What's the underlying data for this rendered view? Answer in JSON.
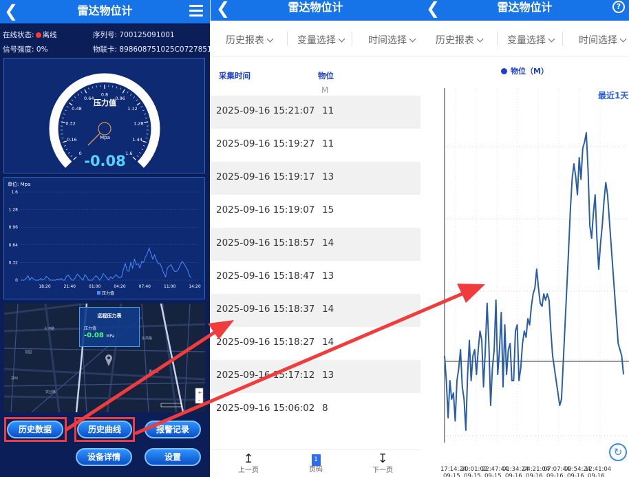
{
  "dashboard": {
    "title": "雷达物位计",
    "online_status_label": "在线状态:",
    "online_status_value": "离线",
    "serial_label": "序列号:",
    "serial_value": "700125091001",
    "signal_label": "信号强度:",
    "signal_value": "0%",
    "iot_card_label": "物联卡:",
    "iot_card_value": "898608751025C0727851",
    "gauge": {
      "title": "压力值",
      "unit": "Mpa",
      "value": "-0.08",
      "value_number": -0.08,
      "min": 0,
      "max": 1.6,
      "ticks": [
        "0",
        "0.16",
        "0.32",
        "0.48",
        "0.64",
        "0.8",
        "0.96",
        "1.12",
        "1.28",
        "1.44",
        "1.6"
      ]
    },
    "mini_chart": {
      "type": "line",
      "unit_label": "单位: Mpa",
      "ytick_labels": [
        "0",
        "0.32",
        "0.64",
        "0.96",
        "1.28",
        "1.6"
      ],
      "ylim": [
        0,
        1.6
      ],
      "xtick_labels": [
        "18:20",
        "21:40",
        "01:00",
        "04:20",
        "07:40",
        "11:00",
        "14:20"
      ],
      "legend": "压力值",
      "series_values": [
        0.0,
        0.0,
        0.0,
        0.03,
        0.08,
        0.0,
        0.05,
        0.02,
        0.0,
        0.0,
        0.0,
        0.03,
        0.0,
        0.02,
        0.07,
        0.04,
        0.0,
        0.0,
        0.0,
        0.0,
        0.02,
        0.0,
        0.03,
        0.0,
        0.0,
        0.07,
        0.09,
        0.04,
        0.0,
        0.0,
        0.06,
        0.11,
        0.07,
        0.03,
        0.0,
        0.1,
        0.06,
        0.0,
        0.0,
        0.0,
        0.04,
        0.08,
        0.05,
        0.0,
        0.04,
        0.12,
        0.08,
        0.04,
        0.0,
        0.06,
        0.03,
        0.06,
        0.1,
        0.06,
        0.04,
        0.06,
        0.2,
        0.3,
        0.18,
        0.16,
        0.32,
        0.22,
        0.38,
        0.28,
        0.3,
        0.22,
        0.34,
        0.32,
        0.42,
        0.48,
        0.58,
        0.48,
        0.38,
        0.46,
        0.36,
        0.3,
        0.3,
        0.22,
        0.12,
        0.06,
        0.22,
        0.26,
        0.28,
        0.2,
        0.16,
        0.16,
        0.2,
        0.28,
        0.34,
        0.3,
        0.24,
        0.18,
        0.08,
        0.04
      ]
    },
    "remote_card": {
      "title": "远程压力表",
      "label": "压力值",
      "value": "-0.08",
      "unit": "MPa"
    },
    "buttons": {
      "history_data": "历史数据",
      "history_curve": "历史曲线",
      "alarm_records": "报警记录",
      "device_details": "设备详情",
      "settings": "设置"
    }
  },
  "history_table": {
    "title": "雷达物位计",
    "filters": [
      "历史报表",
      "变量选择",
      "时间选择"
    ],
    "columns": {
      "time": "采集时间",
      "level": "物位",
      "level_unit": "M"
    },
    "rows": [
      {
        "time": "2025-09-16 15:21:07",
        "value": "11"
      },
      {
        "time": "2025-09-16 15:19:27",
        "value": "11"
      },
      {
        "time": "2025-09-16 15:19:17",
        "value": "13"
      },
      {
        "time": "2025-09-16 15:19:07",
        "value": "15"
      },
      {
        "time": "2025-09-16 15:18:57",
        "value": "14"
      },
      {
        "time": "2025-09-16 15:18:47",
        "value": "13"
      },
      {
        "time": "2025-09-16 15:18:37",
        "value": "14"
      },
      {
        "time": "2025-09-16 15:18:27",
        "value": "14"
      },
      {
        "time": "2025-09-16 15:17:12",
        "value": "13"
      },
      {
        "time": "2025-09-16 15:06:02",
        "value": "8"
      }
    ],
    "footer": {
      "prev_page": "上一页",
      "page_number": "1",
      "page_label": "页码",
      "next_page": "下一页"
    }
  },
  "history_curve": {
    "title": "雷达物位计",
    "filters": [
      "历史报表",
      "变量选择",
      "时间选择"
    ],
    "legend": "物位（M）",
    "range_label": "最近1天",
    "help_icon": "question-circle-icon",
    "refresh_icon": "refresh-icon",
    "xtick_labels": [
      {
        "time": "17:14:24",
        "date": "09-15"
      },
      {
        "time": "20:01:02",
        "date": "09-15"
      },
      {
        "time": "22:47:44",
        "date": "09-15"
      },
      {
        "time": "01:34:24",
        "date": "09-16"
      },
      {
        "time": "04:21:04",
        "date": "09-16"
      },
      {
        "time": "07:07:44",
        "date": "09-16"
      },
      {
        "time": "09:54:24",
        "date": "09-16"
      },
      {
        "time": "12:41:04",
        "date": "09-16"
      }
    ],
    "series_relative_levels": [
      0.28,
      0.2,
      0.08,
      0.2,
      0.14,
      0.16,
      0.07,
      0.2,
      0.24,
      0.3,
      0.18,
      0.14,
      0.04,
      0.22,
      0.33,
      0.2,
      0.28,
      0.3,
      0.22,
      0.3,
      0.36,
      0.33,
      0.18,
      0.3,
      0.45,
      0.32,
      0.12,
      0.24,
      0.3,
      0.46,
      0.22,
      0.3,
      0.42,
      0.18,
      0.38,
      0.22,
      0.3,
      0.32,
      0.2,
      0.2,
      0.36,
      0.38,
      0.2,
      0.24,
      0.32,
      0.36,
      0.34,
      0.4,
      0.38,
      0.44,
      0.48,
      0.5,
      0.56,
      0.5,
      0.45,
      0.44,
      0.48,
      0.46,
      0.48,
      0.46,
      0.36,
      0.28,
      0.24,
      0.2,
      0.16,
      0.12,
      0.14,
      0.26,
      0.38,
      0.5,
      0.62,
      0.75,
      0.85,
      0.9,
      0.86,
      0.8,
      0.92,
      0.85,
      0.95,
      0.97,
      1.0,
      0.88,
      0.7,
      0.66,
      0.74,
      0.8,
      0.66,
      0.56,
      0.64,
      0.7,
      0.78,
      0.84,
      0.8,
      0.72,
      0.64,
      0.56,
      0.48,
      0.4,
      0.32,
      0.3,
      0.28,
      0.22
    ]
  },
  "colors": {
    "accent": "#1674e8",
    "dashboard_bg": "#0b1e57",
    "table_header": "#1c3ec9",
    "curve_line": "#2a5da8",
    "annotation_red": "#f03c3c",
    "gauge_value": "#56d2ff"
  }
}
